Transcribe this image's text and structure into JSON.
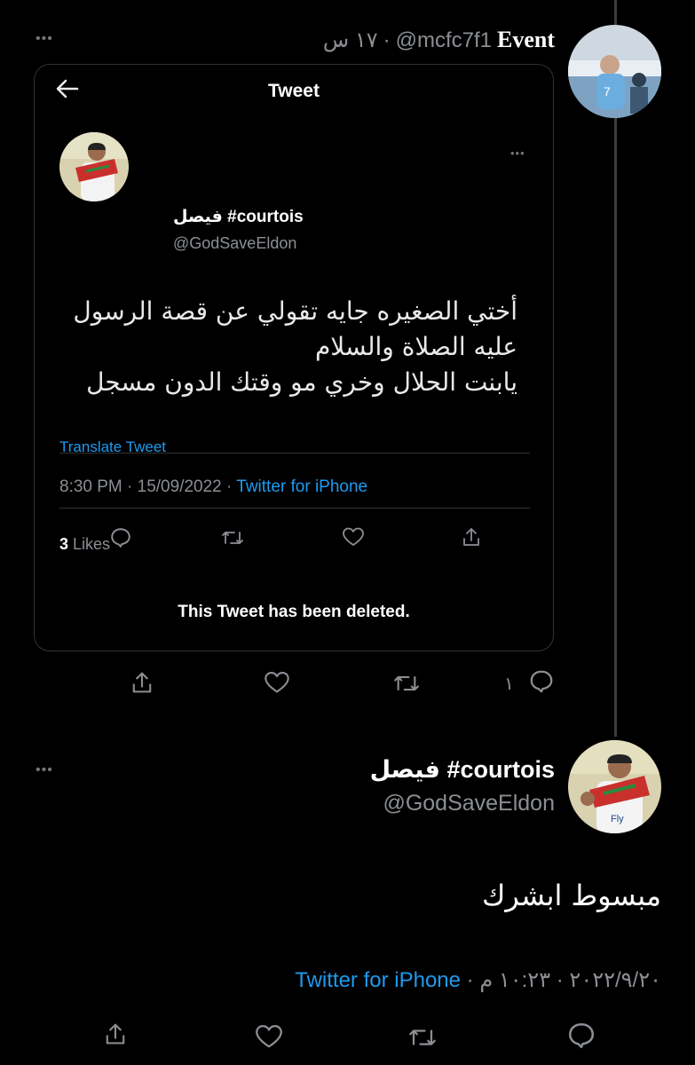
{
  "reply_header": {
    "display_name": "Event",
    "handle": "@mcfc7f1",
    "time": "١٧ س",
    "separator": "·"
  },
  "quoted_card": {
    "title": "Tweet",
    "author_name": "فيصل #courtois",
    "author_handle": "@GodSaveEldon",
    "body_lines": [
      "أختي الصغيره جايه تقولي عن قصة الرسول",
      "عليه الصلاة والسلام",
      "يابنت الحلال وخري مو وقتك الدون مسجل"
    ],
    "translate_label": "Translate Tweet",
    "timestamp": "8:30 PM · 15/09/2022 · ",
    "source": "Twitter for iPhone",
    "likes_count": "3",
    "likes_label": " Likes",
    "deleted_notice": "This Tweet has been deleted."
  },
  "reply_actions": {
    "reply_count": "١"
  },
  "main_tweet": {
    "author_name": "فيصل #courtois",
    "author_handle": "@GodSaveEldon",
    "body": "مبسوط ابشرك",
    "date_time": "٢٠٢٢/٩/٢٠ · ١٠:٢٣ م · ",
    "source": "Twitter for iPhone"
  },
  "colors": {
    "background": "#000000",
    "text": "#e7e9ea",
    "muted": "#8b8f94",
    "link": "#1d9bf0",
    "border": "#2f3336"
  },
  "icons": {
    "more": "more-dots-icon",
    "back": "back-arrow-icon",
    "reply": "reply-bubble-icon",
    "retweet": "retweet-icon",
    "like": "heart-icon",
    "share": "share-icon"
  }
}
